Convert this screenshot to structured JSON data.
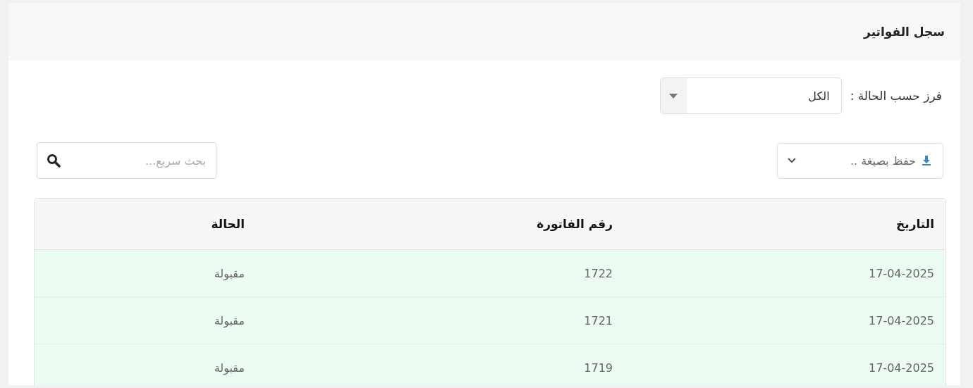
{
  "panel": {
    "title": "سجل الفواتير"
  },
  "filter": {
    "label": "فرز حسب الحالة :",
    "value": "الكل"
  },
  "export": {
    "label": "حفظ بصيغة .."
  },
  "search": {
    "placeholder": "بحث سريع..."
  },
  "table": {
    "columns": [
      "التاريخ",
      "رقم الفاتورة",
      "الحالة"
    ],
    "rows": [
      {
        "cells": [
          "17-04-2025",
          "1722",
          "مقبولة"
        ],
        "color": "#ebfcf1"
      },
      {
        "cells": [
          "17-04-2025",
          "1721",
          "مقبولة"
        ],
        "color": "#ebfcf1"
      },
      {
        "cells": [
          "17-04-2025",
          "1719",
          "مقبولة"
        ],
        "color": "#ebfcf1"
      }
    ]
  }
}
